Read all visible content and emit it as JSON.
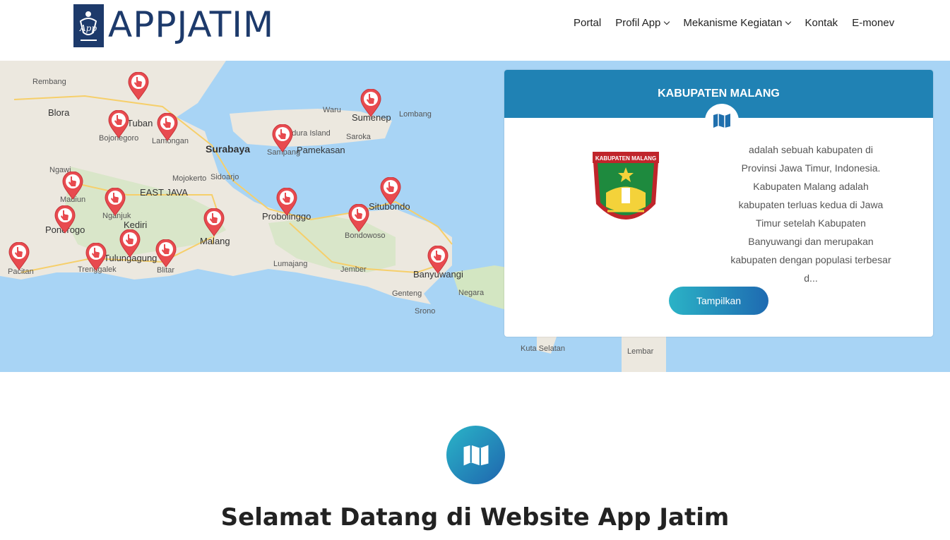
{
  "header": {
    "logo_text": "APPJATIM",
    "logo_icon": "app-logo-icon",
    "nav": [
      {
        "label": "Portal",
        "dropdown": false
      },
      {
        "label": "Profil App",
        "dropdown": true
      },
      {
        "label": "Mekanisme Kegiatan",
        "dropdown": true
      },
      {
        "label": "Kontak",
        "dropdown": false
      },
      {
        "label": "E-monev",
        "dropdown": false
      }
    ]
  },
  "map": {
    "region_label": "EAST JAVA",
    "labels": [
      "Rembang",
      "Blora",
      "Tuban",
      "Bojonegoro",
      "Lamongan",
      "Surabaya",
      "Mojokerto",
      "Sidoarjo",
      "Ngawi",
      "Madiun",
      "Nganjuk",
      "Kediri",
      "Ponorogo",
      "Pacitan",
      "Trenggalek",
      "Tulungagung",
      "Blitar",
      "Malang",
      "Lumajang",
      "Jember",
      "Probolinggo",
      "Bondowoso",
      "Situbondo",
      "Banyuwangi",
      "Genteng",
      "Srono",
      "Negara",
      "Kuta Selatan",
      "Lembar",
      "Sampang",
      "Pamekasan",
      "Sumenep",
      "Saroka",
      "Waru",
      "Lombang",
      "Madura Island"
    ],
    "marker_icon": "map-pin-hand-icon"
  },
  "card": {
    "title": "KABUPATEN MALANG",
    "badge_icon": "map-icon",
    "emblem_text": "KABUPATEN MALANG",
    "description": "adalah sebuah kabupaten di Provinsi Jawa Timur, Indonesia. Kabupaten Malang adalah kabupaten terluas kedua di Jawa Timur setelah Kabupaten Banyuwangi dan merupakan kabupaten dengan populasi terbesar d...",
    "button_label": "Tampilkan"
  },
  "welcome": {
    "icon": "map-icon",
    "title": "Selamat Datang di Website App Jatim"
  },
  "colors": {
    "brand": "#1d3a6b",
    "card_header": "#2082b4",
    "marker": "#e84a4f",
    "sea": "#a8d4f5"
  }
}
